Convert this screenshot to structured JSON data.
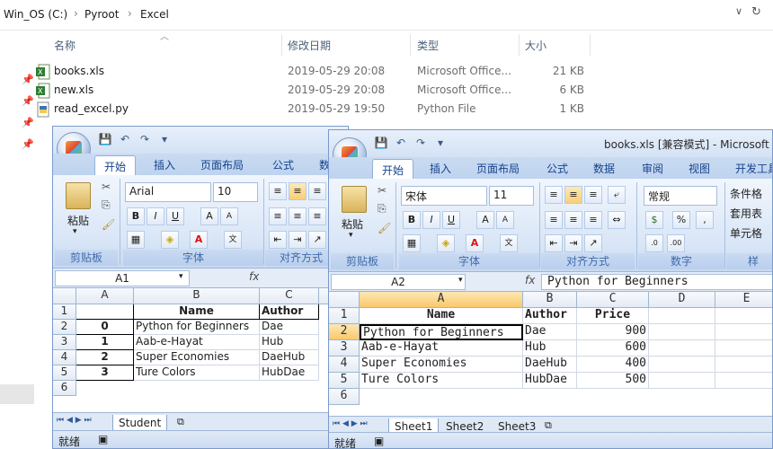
{
  "explorer": {
    "breadcrumbs": [
      "Win_OS (C:)",
      "Pyroot",
      "Excel"
    ],
    "columns": [
      "名称",
      "修改日期",
      "类型",
      "大小"
    ],
    "files": [
      {
        "name": "books.xls",
        "date": "2019-05-29 20:08",
        "type": "Microsoft Office...",
        "size": "21 KB",
        "icon": "excel-file-icon"
      },
      {
        "name": "new.xls",
        "date": "2019-05-29 20:08",
        "type": "Microsoft Office...",
        "size": "6 KB",
        "icon": "excel-file-icon"
      },
      {
        "name": "read_excel.py",
        "date": "2019-05-29 19:50",
        "type": "Python File",
        "size": "1 KB",
        "icon": "python-file-icon"
      }
    ]
  },
  "excel_new": {
    "tabs": [
      "开始",
      "插入",
      "页面布局",
      "公式",
      "数"
    ],
    "font_name": "Arial",
    "font_size": "10",
    "paste_label": "粘贴",
    "groups": [
      "剪贴板",
      "字体",
      "对齐方式"
    ],
    "name_box": "A1",
    "columns": [
      "A",
      "B",
      "C"
    ],
    "rows": [
      [
        "",
        "Name",
        "Author"
      ],
      [
        "0",
        "Python for Beginners",
        "Dae"
      ],
      [
        "1",
        "Aab-e-Hayat",
        "Hub"
      ],
      [
        "2",
        "Super Economies",
        "DaeHub"
      ],
      [
        "3",
        "Ture Colors",
        "HubDae"
      ]
    ],
    "row_numbers": [
      "1",
      "2",
      "3",
      "4",
      "5",
      "6"
    ],
    "sheet_tab": "Student",
    "status": "就绪"
  },
  "excel_books": {
    "title": "books.xls  [兼容模式] - Microsoft",
    "tabs": [
      "开始",
      "插入",
      "页面布局",
      "公式",
      "数据",
      "审阅",
      "视图",
      "开发工具"
    ],
    "font_name": "宋体",
    "font_size": "11",
    "number_format": "常规",
    "paste_label": "粘贴",
    "groups": [
      "剪贴板",
      "字体",
      "对齐方式",
      "数字",
      "样"
    ],
    "style_items": [
      "条件格",
      "套用表",
      "单元格"
    ],
    "name_box": "A2",
    "formula": "Python for Beginners",
    "columns": [
      "A",
      "B",
      "C",
      "D",
      "E"
    ],
    "rows": [
      [
        "Name",
        "Author",
        "Price"
      ],
      [
        "Python for Beginners",
        "Dae",
        "900"
      ],
      [
        "Aab-e-Hayat",
        "Hub",
        "600"
      ],
      [
        "Super Economies",
        "DaeHub",
        "400"
      ],
      [
        "Ture Colors",
        "HubDae",
        "500"
      ]
    ],
    "row_numbers": [
      "1",
      "2",
      "3",
      "4",
      "5",
      "6"
    ],
    "sheet_tabs": [
      "Sheet1",
      "Sheet2",
      "Sheet3"
    ],
    "status": "就绪"
  }
}
